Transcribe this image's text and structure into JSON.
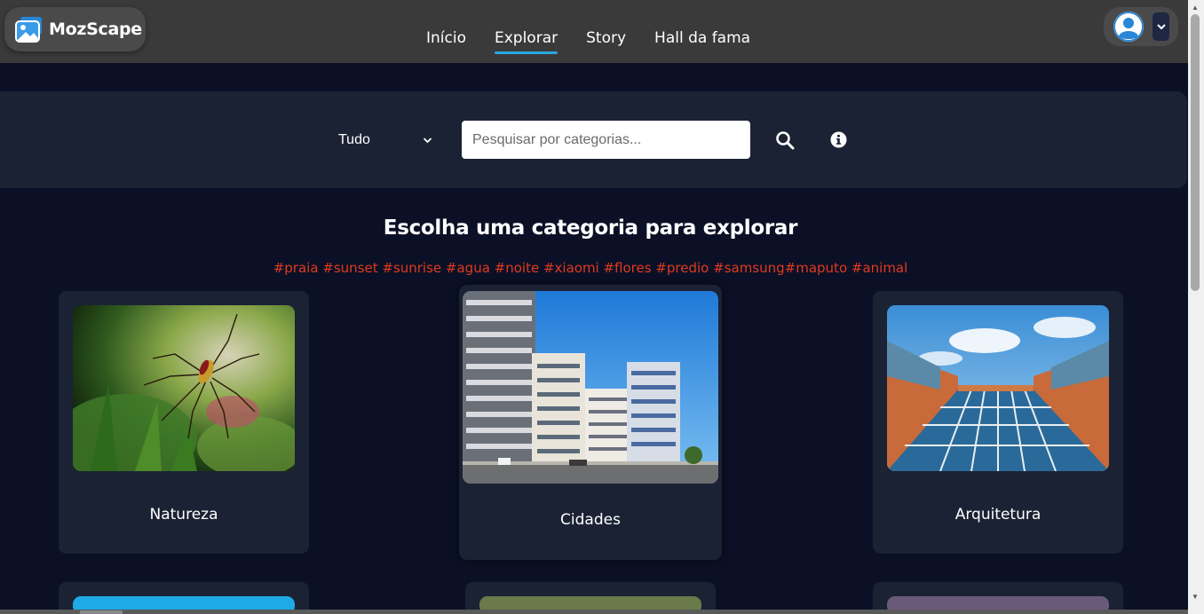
{
  "app": {
    "name": "MozScape"
  },
  "nav": {
    "links": [
      {
        "label": "Início",
        "active": false
      },
      {
        "label": "Explorar",
        "active": true
      },
      {
        "label": "Story",
        "active": false
      },
      {
        "label": "Hall da fama",
        "active": false
      }
    ]
  },
  "user": {
    "avatar_icon": "user-avatar-icon",
    "menu_icon": "chevron-down-icon"
  },
  "search": {
    "filter_value": "Tudo",
    "placeholder": "Pesquisar por categorias...",
    "search_icon": "search-icon",
    "info_icon": "info-icon"
  },
  "main": {
    "heading": "Escolha uma categoria para explorar",
    "tags": "#praia #sunset #sunrise #agua #noite #xiaomi #flores #predio #samsung#maputo #animal"
  },
  "categories": [
    {
      "label": "Natureza"
    },
    {
      "label": "Cidades"
    },
    {
      "label": "Arquitetura"
    }
  ],
  "colors": {
    "background": "#0b1026",
    "navbar": "#3a3a3a",
    "panel": "#1b2234",
    "accent": "#2aa7e0",
    "tag": "#e03a1e"
  }
}
